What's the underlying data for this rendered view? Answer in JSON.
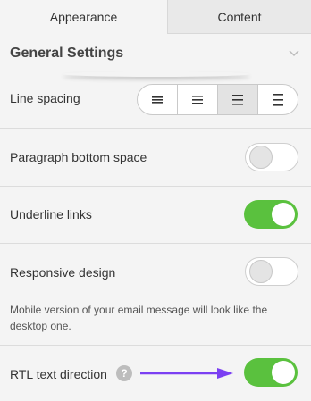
{
  "tabs": [
    {
      "label": "Appearance",
      "active": true
    },
    {
      "label": "Content",
      "active": false
    }
  ],
  "section": {
    "title": "General Settings",
    "expanded": true
  },
  "line_spacing": {
    "label": "Line spacing",
    "options": [
      "compact-spacing-icon",
      "normal-spacing-icon",
      "medium-spacing-icon",
      "wide-spacing-icon"
    ],
    "selected_index": 2
  },
  "paragraph_bottom_space": {
    "label": "Paragraph bottom space",
    "enabled": false
  },
  "underline_links": {
    "label": "Underline links",
    "enabled": true
  },
  "responsive_design": {
    "label": "Responsive design",
    "enabled": false,
    "description": "Mobile version of your email message will look like the desktop one."
  },
  "rtl_text_direction": {
    "label": "RTL text direction",
    "help": "?",
    "enabled": true
  },
  "colors": {
    "toggle_on": "#5ac13e",
    "arrow": "#7b3ff2"
  }
}
